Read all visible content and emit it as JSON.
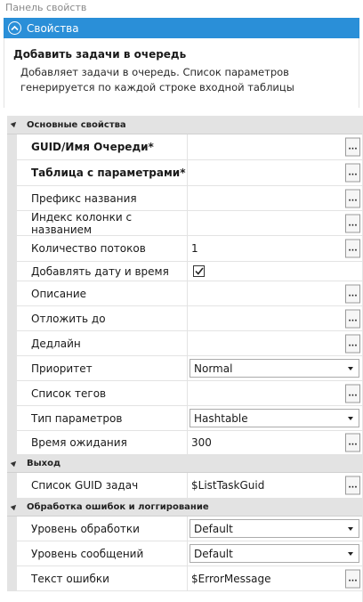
{
  "panel_title": "Панель свойств",
  "section": {
    "title": "Свойства"
  },
  "description": {
    "title": "Добавить задачи в очередь",
    "text": "Добавляет задачи в очередь. Список параметров генерируется по каждой строке входной таблицы"
  },
  "categories": {
    "main": "Основные свойства",
    "output": "Выход",
    "errors": "Обработка ошибок и логгирование"
  },
  "props": {
    "guid": {
      "label": "GUID/Имя Очереди*",
      "value": ""
    },
    "table": {
      "label": "Таблица с параметрами*",
      "value": ""
    },
    "prefix": {
      "label": "Префикс названия",
      "value": ""
    },
    "index": {
      "label": "Индекс колонки с названием",
      "value": ""
    },
    "threads": {
      "label": "Количество потоков",
      "value": "1"
    },
    "add_date": {
      "label": "Добавлять дату и время",
      "checked": true
    },
    "description": {
      "label": "Описание",
      "value": ""
    },
    "delay": {
      "label": "Отложить до",
      "value": ""
    },
    "deadline": {
      "label": "Дедлайн",
      "value": ""
    },
    "priority": {
      "label": "Приоритет",
      "value": "Normal"
    },
    "tags": {
      "label": "Список тегов",
      "value": ""
    },
    "param_type": {
      "label": "Тип параметров",
      "value": "Hashtable"
    },
    "timeout": {
      "label": "Время ожидания",
      "value": "300"
    },
    "guid_list": {
      "label": "Список GUID задач",
      "value": "$ListTaskGuid"
    },
    "handle_level": {
      "label": "Уровень обработки",
      "value": "Default"
    },
    "msg_level": {
      "label": "Уровень сообщений",
      "value": "Default"
    },
    "error_text": {
      "label": "Текст ошибки",
      "value": "$ErrorMessage"
    }
  },
  "ellipsis_label": "...",
  "icons": {
    "collapse": "chevron-up-icon",
    "category_toggle": "triangle-icon",
    "dropdown": "caret-down-icon",
    "checkbox": "check-icon"
  },
  "colors": {
    "accent": "#2a8fd8",
    "category_bg": "#e3e3e3"
  }
}
